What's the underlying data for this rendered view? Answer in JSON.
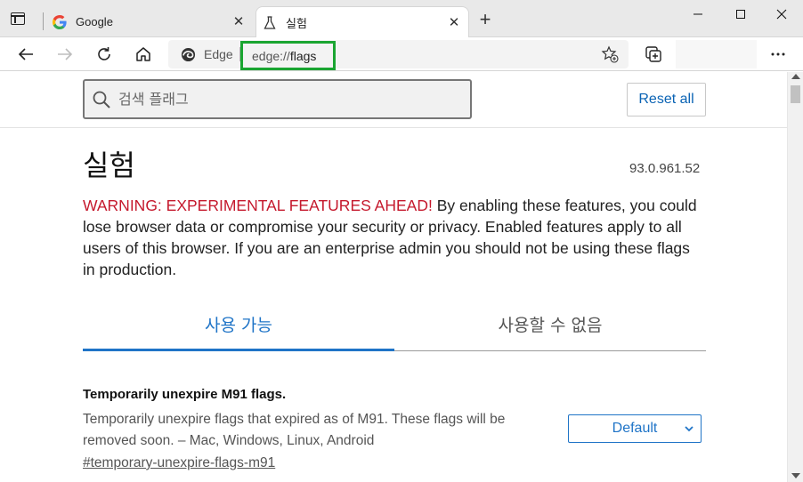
{
  "window": {
    "tabs": [
      {
        "title": "Google",
        "icon": "google-icon"
      },
      {
        "title": "실험",
        "icon": "flask-icon"
      }
    ]
  },
  "toolbar": {
    "identity_chip": "Edge",
    "url_scheme": "edge://",
    "url_path": "flags",
    "url_highlight_color": "#1aa531"
  },
  "flags_page": {
    "search_placeholder": "검색 플래그",
    "reset_label": "Reset all",
    "title": "실험",
    "version": "93.0.961.52",
    "warning_label": "WARNING: EXPERIMENTAL FEATURES AHEAD!",
    "warning_text": " By enabling these features, you could lose browser data or compromise your security or privacy. Enabled features apply to all users of this browser. If you are an enterprise admin you should not be using these flags in production.",
    "tabs": [
      {
        "label": "사용 가능",
        "selected": true
      },
      {
        "label": "사용할 수 없음",
        "selected": false
      }
    ],
    "flags": [
      {
        "title": "Temporarily unexpire M91 flags.",
        "description": "Temporarily unexpire flags that expired as of M91. These flags will be removed soon. – Mac, Windows, Linux, Android",
        "link": "#temporary-unexpire-flags-m91",
        "selected_value": "Default"
      }
    ]
  },
  "colors": {
    "accent": "#1f74c7",
    "warning": "#c5192d"
  }
}
